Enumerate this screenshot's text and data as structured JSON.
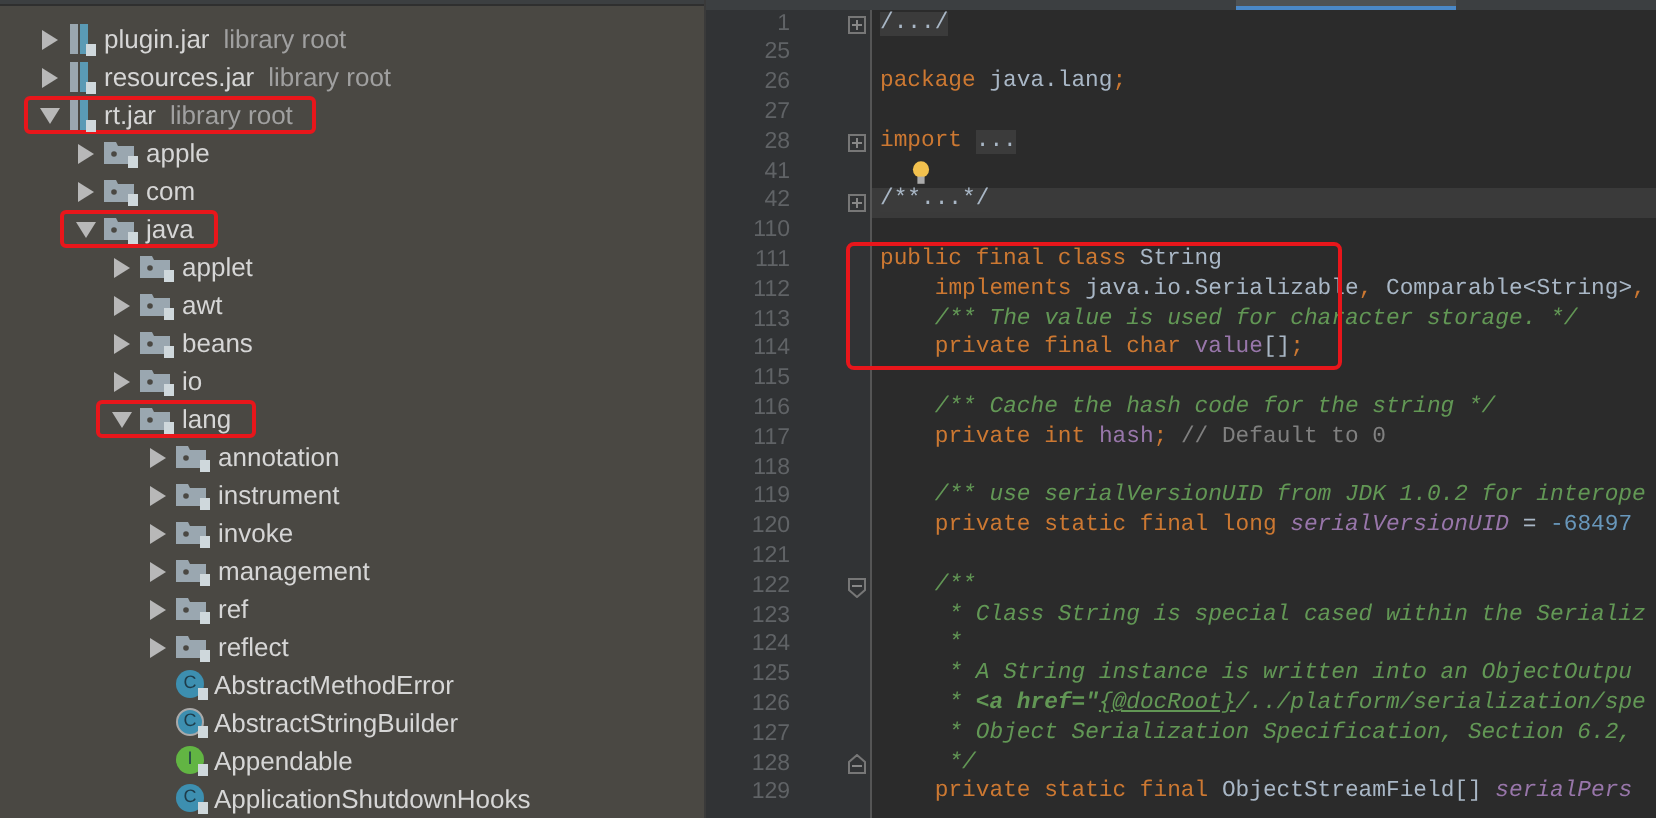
{
  "tree": [
    {
      "name": "plugin.jar",
      "note": "library root",
      "kind": "jar",
      "expanded": false,
      "highlighted": false
    },
    {
      "name": "resources.jar",
      "note": "library root",
      "kind": "jar",
      "expanded": false,
      "highlighted": false
    },
    {
      "name": "rt.jar",
      "note": "library root",
      "kind": "jar",
      "expanded": true,
      "highlighted": true,
      "children": [
        {
          "name": "apple",
          "kind": "package",
          "expanded": false,
          "highlighted": false
        },
        {
          "name": "com",
          "kind": "package",
          "expanded": false,
          "highlighted": false
        },
        {
          "name": "java",
          "kind": "package",
          "expanded": true,
          "highlighted": true,
          "children": [
            {
              "name": "applet",
              "kind": "package",
              "expanded": false,
              "highlighted": false
            },
            {
              "name": "awt",
              "kind": "package",
              "expanded": false,
              "highlighted": false
            },
            {
              "name": "beans",
              "kind": "package",
              "expanded": false,
              "highlighted": false
            },
            {
              "name": "io",
              "kind": "package",
              "expanded": false,
              "highlighted": false
            },
            {
              "name": "lang",
              "kind": "package",
              "expanded": true,
              "highlighted": true,
              "children": [
                {
                  "name": "annotation",
                  "kind": "package",
                  "expanded": false,
                  "highlighted": false
                },
                {
                  "name": "instrument",
                  "kind": "package",
                  "expanded": false,
                  "highlighted": false
                },
                {
                  "name": "invoke",
                  "kind": "package",
                  "expanded": false,
                  "highlighted": false
                },
                {
                  "name": "management",
                  "kind": "package",
                  "expanded": false,
                  "highlighted": false
                },
                {
                  "name": "ref",
                  "kind": "package",
                  "expanded": false,
                  "highlighted": false
                },
                {
                  "name": "reflect",
                  "kind": "package",
                  "expanded": false,
                  "highlighted": false
                },
                {
                  "name": "AbstractMethodError",
                  "kind": "class",
                  "letter": "C",
                  "highlighted": false
                },
                {
                  "name": "AbstractStringBuilder",
                  "kind": "abstract",
                  "letter": "C",
                  "highlighted": false
                },
                {
                  "name": "Appendable",
                  "kind": "interface",
                  "letter": "I",
                  "highlighted": false
                },
                {
                  "name": "ApplicationShutdownHooks",
                  "kind": "class",
                  "letter": "C",
                  "highlighted": false
                }
              ]
            }
          ]
        }
      ]
    }
  ],
  "code": [
    {
      "num": "1",
      "collapsed": true,
      "tokens": [
        {
          "kind": "folded",
          "text": "/.../"
        }
      ]
    },
    {
      "num": "25"
    },
    {
      "num": "26",
      "tokens": [
        {
          "kind": "kw",
          "text": "package"
        },
        {
          "kind": "plain",
          "text": "java.lang"
        },
        {
          "kind": "kw",
          "text": ";"
        }
      ]
    },
    {
      "num": "27"
    },
    {
      "num": "28",
      "collapsed": true,
      "tokens": [
        {
          "kind": "kw",
          "text": "import"
        },
        {
          "kind": "folded",
          "text": "..."
        }
      ]
    },
    {
      "num": "41",
      "bulb": true
    },
    {
      "num": "42",
      "collapsed": true,
      "current": true,
      "tokens": [
        {
          "kind": "folded",
          "text": "/**...*/"
        }
      ]
    },
    {
      "num": "110"
    },
    {
      "num": "111",
      "highlighted": true,
      "tokens": [
        {
          "kind": "kw",
          "text": "public final class"
        },
        {
          "kind": "plain",
          "text": "String"
        }
      ]
    },
    {
      "num": "112",
      "highlighted": true,
      "indent": true,
      "tokens": [
        {
          "kind": "kw",
          "text": "implements"
        },
        {
          "kind": "plain",
          "text": "java.io.Serializable"
        },
        {
          "kind": "kw",
          "text": ","
        },
        {
          "kind": "plain",
          "text": "Comparable<String>"
        },
        {
          "kind": "kw",
          "text": ","
        }
      ]
    },
    {
      "num": "113",
      "highlighted": true,
      "indent": true,
      "tokens": [
        {
          "kind": "doc",
          "text": "/** The value is used for character storage. */"
        }
      ]
    },
    {
      "num": "114",
      "highlighted": true,
      "indent": true,
      "tokens": [
        {
          "kind": "kw",
          "text": "private final char"
        },
        {
          "kind": "field",
          "text": "value"
        },
        {
          "kind": "plain",
          "text": "[]"
        },
        {
          "kind": "kw",
          "text": ";"
        }
      ]
    },
    {
      "num": "115"
    },
    {
      "num": "116",
      "indent": true,
      "tokens": [
        {
          "kind": "doc",
          "text": "/** Cache the hash code for the string */"
        }
      ]
    },
    {
      "num": "117",
      "indent": true,
      "tokens": [
        {
          "kind": "kw",
          "text": "private int"
        },
        {
          "kind": "field",
          "text": "hash"
        },
        {
          "kind": "kw",
          "text": ";"
        },
        {
          "kind": "comment",
          "text": "// Default to 0"
        }
      ]
    },
    {
      "num": "118"
    },
    {
      "num": "119",
      "indent": true,
      "tokens": [
        {
          "kind": "doc",
          "text": "/** use serialVersionUID from JDK 1.0.2 for interope"
        }
      ]
    },
    {
      "num": "120",
      "indent": true,
      "tokens": [
        {
          "kind": "kw",
          "text": "private static final long"
        },
        {
          "kind": "sfield",
          "text": "serialVersionUID"
        },
        {
          "kind": "plain",
          "text": "="
        },
        {
          "kind": "num",
          "text": "-68497"
        }
      ]
    },
    {
      "num": "121"
    },
    {
      "num": "122",
      "fold_start": true,
      "indent": true,
      "tokens": [
        {
          "kind": "doc",
          "text": "/**"
        }
      ]
    },
    {
      "num": "123",
      "indent": true,
      "tokens": [
        {
          "kind": "doc",
          "text": " * Class String is special cased within the Serializ"
        }
      ]
    },
    {
      "num": "124",
      "indent": true,
      "tokens": [
        {
          "kind": "doc",
          "text": " *"
        }
      ]
    },
    {
      "num": "125",
      "indent": true,
      "tokens": [
        {
          "kind": "doc",
          "text": " * A String instance is written into an ObjectOutpu"
        }
      ]
    },
    {
      "num": "126",
      "indent": true,
      "tokens": [
        {
          "kind": "doc",
          "text": " *"
        },
        {
          "kind": "doctag",
          "text": "<a href=\""
        },
        {
          "kind": "doclink",
          "text": "{@docRoot}"
        },
        {
          "kind": "doc",
          "text": "/../platform/serialization/spe"
        }
      ]
    },
    {
      "num": "127",
      "indent": true,
      "tokens": [
        {
          "kind": "doc",
          "text": " * Object Serialization Specification, Section 6.2,"
        }
      ]
    },
    {
      "num": "128",
      "fold_end": true,
      "indent": true,
      "tokens": [
        {
          "kind": "doc",
          "text": " */"
        }
      ]
    },
    {
      "num": "129",
      "indent": true,
      "tokens": [
        {
          "kind": "kw",
          "text": "private static final"
        },
        {
          "kind": "plain",
          "text": "ObjectStreamField[]"
        },
        {
          "kind": "sfield",
          "text": "serialPers"
        }
      ]
    }
  ]
}
